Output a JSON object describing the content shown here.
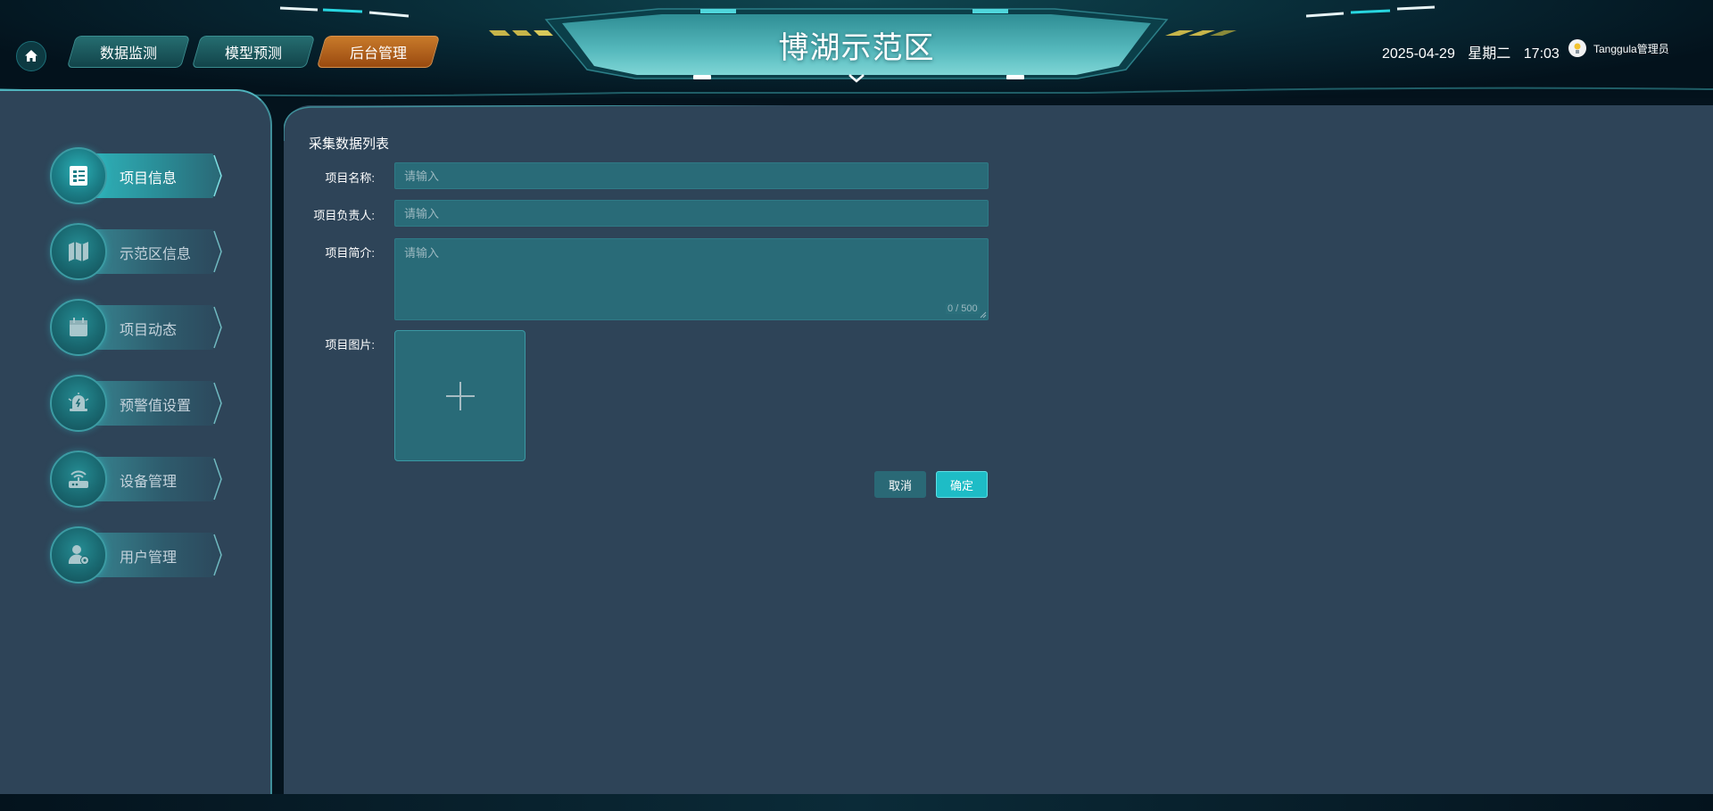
{
  "header": {
    "title": "博湖示范区",
    "nav_tabs": [
      {
        "label": "数据监测"
      },
      {
        "label": "模型预测"
      },
      {
        "label": "后台管理",
        "active": true
      }
    ],
    "date": "2025-04-29",
    "weekday": "星期二",
    "time": "17:03",
    "user_name": "Tanggula管理员",
    "icons": {
      "home": "home-icon",
      "avatar": "avatar-icon",
      "chevron": "chevron-down-icon"
    }
  },
  "sidebar": {
    "items": [
      {
        "label": "项目信息",
        "icon": "document-list-icon",
        "active": true
      },
      {
        "label": "示范区信息",
        "icon": "map-icon"
      },
      {
        "label": "项目动态",
        "icon": "calendar-icon"
      },
      {
        "label": "预警值设置",
        "icon": "alarm-bell-icon"
      },
      {
        "label": "设备管理",
        "icon": "router-icon"
      },
      {
        "label": "用户管理",
        "icon": "user-settings-icon"
      }
    ]
  },
  "main": {
    "panel_title": "采集数据列表",
    "form": {
      "name_label": "项目名称:",
      "name_placeholder": "请输入",
      "leader_label": "项目负责人:",
      "leader_placeholder": "请输入",
      "intro_label": "项目简介:",
      "intro_placeholder": "请输入",
      "intro_counter": "0 / 500",
      "image_label": "项目图片:",
      "upload_icon": "plus-icon"
    },
    "buttons": {
      "cancel": "取消",
      "confirm": "确定"
    }
  },
  "colors": {
    "accent": "#1ebcc6",
    "active_tab": "#b0631e",
    "panel_bg": "#2e4458",
    "input_bg": "#296b78"
  }
}
